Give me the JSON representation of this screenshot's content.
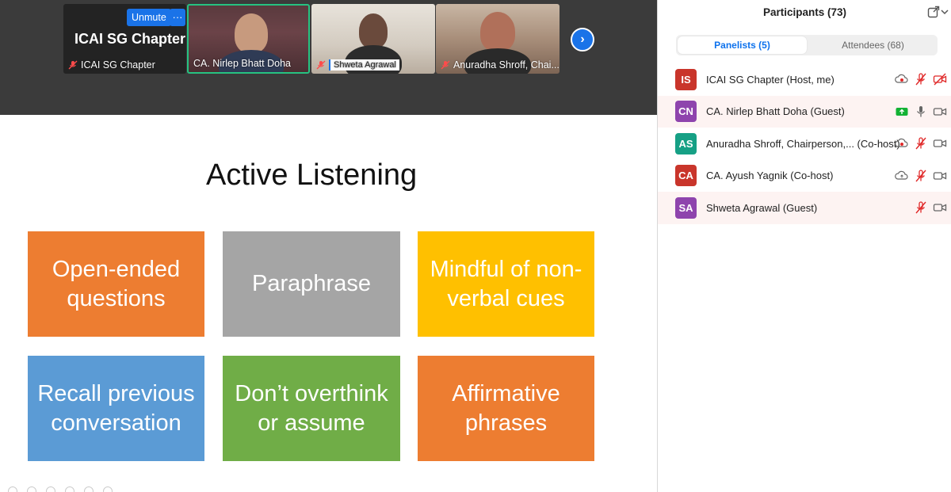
{
  "video_strip": {
    "tiles": [
      {
        "name": "ICAI SG Chapter",
        "display_text": "ICAI SG Chapter",
        "unmute_label": "Unmute",
        "more_label": "···"
      },
      {
        "name": "CA. Nirlep Bhatt Doha"
      },
      {
        "name": "Shweta Agrawal"
      },
      {
        "name": "Anuradha Shroff, Chai..."
      }
    ],
    "next_label": "›"
  },
  "slide": {
    "title": "Active Listening",
    "boxes": [
      {
        "text": "Open-ended questions",
        "color": "#ed7d31"
      },
      {
        "text": "Paraphrase",
        "color": "#a5a5a5"
      },
      {
        "text": "Mindful of non-verbal cues",
        "color": "#ffc000"
      },
      {
        "text": "Recall previous conversation",
        "color": "#5b9bd5"
      },
      {
        "text": "Don’t overthink or assume",
        "color": "#70ad47"
      },
      {
        "text": "Affirmative phrases",
        "color": "#ed7d31"
      }
    ]
  },
  "panel": {
    "title": "Participants (73)",
    "tabs": [
      {
        "label": "Panelists (5)",
        "active": true
      },
      {
        "label": "Attendees (68)",
        "active": false
      }
    ],
    "participants": [
      {
        "initials": "IS",
        "name": "ICAI SG Chapter (Host, me)",
        "avatar_color": "#c9352b",
        "icons": [
          "cloud-record-icon",
          "mic-muted-icon",
          "video-off-icon"
        ]
      },
      {
        "initials": "CN",
        "name": "CA. Nirlep Bhatt Doha (Guest)",
        "avatar_color": "#8e44ad",
        "icons": [
          "share-screen-icon",
          "mic-icon",
          "video-icon"
        ]
      },
      {
        "initials": "AS",
        "name": "Anuradha Shroff, Chairperson,... (Co-host)",
        "avatar_color": "#16a085",
        "icons": [
          "cloud-record-icon",
          "mic-muted-icon",
          "video-icon"
        ]
      },
      {
        "initials": "CA",
        "name": "CA. Ayush Yagnik (Co-host)",
        "avatar_color": "#c9352b",
        "icons": [
          "cloud-icon",
          "mic-muted-icon",
          "video-icon"
        ]
      },
      {
        "initials": "SA",
        "name": "Shweta Agrawal (Guest)",
        "avatar_color": "#8e44ad",
        "icons": [
          "mic-muted-icon",
          "video-icon"
        ]
      }
    ]
  },
  "colors": {
    "accent": "#0e72ed",
    "muted_red": "#e02828",
    "active_border": "#26c281",
    "share_green": "#12b234"
  }
}
